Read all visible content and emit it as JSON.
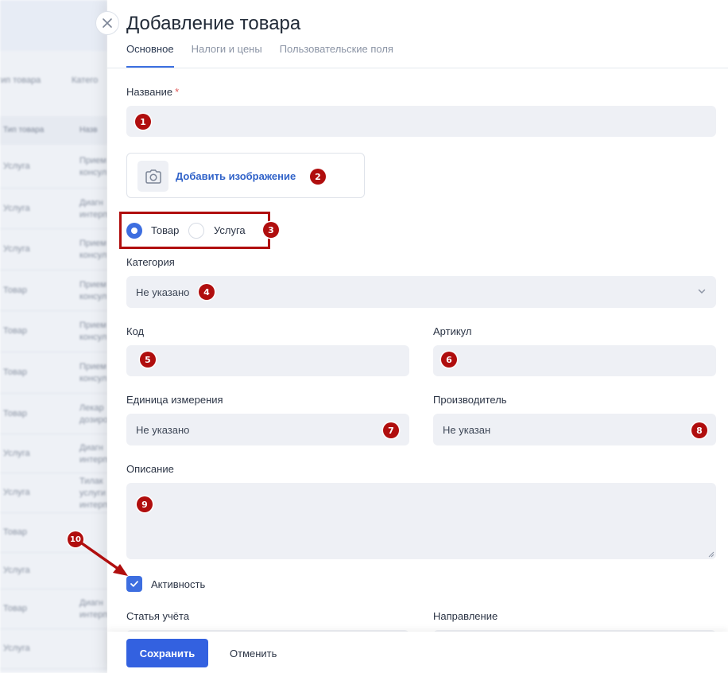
{
  "background": {
    "toolbar": [
      "тип товара",
      "Катего"
    ],
    "table_headers": [
      "Тип товара",
      "Назв"
    ],
    "rows": [
      {
        "type": "Услуга",
        "name": [
          "Прием",
          "консульт"
        ]
      },
      {
        "type": "Услуга",
        "name": [
          "Диагн",
          "интерпр"
        ]
      },
      {
        "type": "Услуга",
        "name": [
          "Прием",
          "консульт"
        ]
      },
      {
        "type": "Товар",
        "name": [
          "Прием",
          "консульт"
        ]
      },
      {
        "type": "Товар",
        "name": [
          "Прием",
          "консульт"
        ]
      },
      {
        "type": "Товар",
        "name": [
          "Прием",
          "консульт"
        ]
      },
      {
        "type": "Товар",
        "name": [
          "Лекар",
          "дозиро"
        ]
      },
      {
        "type": "Услуга",
        "name": [
          "Диагн",
          "интерпр"
        ]
      },
      {
        "type": "Услуга",
        "name": [
          "Тилак",
          "услуги",
          "интерпр"
        ]
      },
      {
        "type": "Товар",
        "name": [
          ""
        ]
      },
      {
        "type": "Услуга",
        "name": [
          ""
        ]
      },
      {
        "type": "Товар",
        "name": [
          "Диагн",
          "интерпр"
        ]
      },
      {
        "type": "Услуга",
        "name": [
          ""
        ]
      }
    ]
  },
  "panel": {
    "title": "Добавление товара",
    "tabs": [
      "Основное",
      "Налоги и цены",
      "Пользовательские поля"
    ],
    "name_label": "Название",
    "required_mark": "*",
    "add_image": "Добавить изображение",
    "radio_options": [
      "Товар",
      "Услуга"
    ],
    "selected_radio": "Товар",
    "category_label": "Категория",
    "category_value": "Не указано",
    "code_label": "Код",
    "article_label": "Артикул",
    "unit_label": "Единица измерения",
    "unit_value": "Не указано",
    "manufacturer_label": "Производитель",
    "manufacturer_value": "Не указан",
    "description_label": "Описание",
    "active_label": "Активность",
    "active_checked": true,
    "account_label": "Статья учёта",
    "direction_label": "Направление",
    "save_label": "Сохранить",
    "cancel_label": "Отменить"
  },
  "annotations": [
    "1",
    "2",
    "3",
    "4",
    "5",
    "6",
    "7",
    "8",
    "9",
    "10"
  ],
  "colors": {
    "accent": "#3361e0",
    "annotation": "#b00e0e",
    "field_bg": "#eef0f5"
  }
}
